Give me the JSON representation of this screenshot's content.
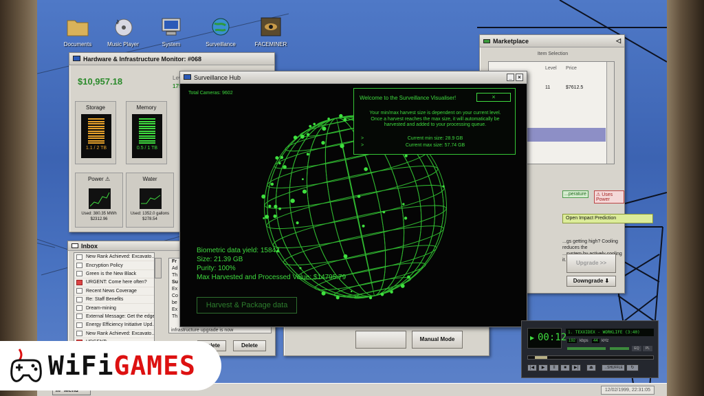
{
  "desktop": {
    "icons": [
      {
        "label": "Documents",
        "icon": "folder-icon"
      },
      {
        "label": "Music Player",
        "icon": "cd-icon"
      },
      {
        "label": "System",
        "icon": "computer-icon"
      },
      {
        "label": "Surveillance",
        "icon": "globe-icon"
      },
      {
        "label": "FACEMINER",
        "icon": "faceminer-icon"
      }
    ]
  },
  "hw_monitor": {
    "title": "Hardware & Infrastructure Monitor: #068",
    "money": "$10,957.18",
    "level_label": "Lev",
    "level_value": "175",
    "storage": {
      "label": "Storage",
      "value": "1.1 / 2 TB"
    },
    "memory": {
      "label": "Memory",
      "value": "0.5 / 1 TB"
    },
    "power": {
      "label": "Power ⚠",
      "used": "Used: 380.35 MWh",
      "cost": "$2312.96"
    },
    "water": {
      "label": "Water",
      "used": "Used: 1352.0 gallons",
      "cost": "$278.54"
    }
  },
  "marketplace": {
    "title": "Marketplace",
    "section": "Item Selection",
    "col_level": "Level",
    "col_price": "Price",
    "row_level": "11",
    "row_price": "$7612.5",
    "status_temp": "...perature",
    "status_power": "⚠ Uses Power",
    "impact_btn": "Open Impact Prediction",
    "desc_1": "...gs getting high? Cooling reduces the",
    "desc_2": "...system by actively cooling it.",
    "upgrade_btn": "Upgrade >>",
    "downgrade_btn": "Downgrade ⬇"
  },
  "hub": {
    "title": "Surveillance Hub",
    "total_cameras": "Total Cameras: 9602",
    "welcome_title": "Welcome to the Surveillance Visualiser!",
    "welcome_close": "×",
    "welcome_line1": "Your min/max harvest size is dependent on your current level.",
    "welcome_line2": "Once a harvest reaches the max size, it will automatically be",
    "welcome_line3": "harvested and added to your processing queue.",
    "min_size": "Current min size: 28.9 GB",
    "max_size": "Current max size: 57.74 GB",
    "bullet": ">",
    "biometric": "Biometric data yield: 15843",
    "size": "Size: 21.39 GB",
    "purity": "Purity: 100%",
    "max_value": "Max Harvested and Processed Value: $14795.79",
    "harvest_btn": "Harvest & Package data"
  },
  "inbox": {
    "title": "Inbox",
    "messages": [
      {
        "subject": "New Rank Achieved: Excavato...",
        "urgent": false
      },
      {
        "subject": "Encryption Policy",
        "urgent": false
      },
      {
        "subject": "Green is the New Black",
        "urgent": false
      },
      {
        "subject": "URGENT: Come here often?",
        "urgent": true
      },
      {
        "subject": "Recent News Coverage",
        "urgent": false
      },
      {
        "subject": "Re: Staff Benefits",
        "urgent": false
      },
      {
        "subject": "Dream-mining",
        "urgent": false
      },
      {
        "subject": "External Message: Get the edge...",
        "urgent": false
      },
      {
        "subject": "Energy Efficiency Initiative Upd...",
        "urgent": false
      },
      {
        "subject": "New Rank Achieved: Excavato...",
        "urgent": false
      },
      {
        "subject": "URGENT: ...",
        "urgent": true
      }
    ],
    "preview_lines": [
      "Fr",
      "Ad",
      "Th",
      "Su",
      "Ex",
      "Co",
      "be",
      "Ex",
      "Th"
    ],
    "preview_tail": "infrastructure upgrade is now",
    "delete_btn_a": "Delete",
    "delete_btn_b": "Delete"
  },
  "panel": {
    "manual_btn": "Manual Mode",
    "auto_btn": ""
  },
  "player": {
    "time": "00:12",
    "track": "1. TEXXIDEX - WORKLIFE (3:40)",
    "kbps": "192",
    "kbps_label": "kbps",
    "khz": "44",
    "khz_label": "kHz",
    "shuffle": "→SHUFFLE",
    "eq": "EQ",
    "pl": "PL"
  },
  "taskbar": {
    "menu": "Menu",
    "clock": "12/02/1999, 22:31:05"
  },
  "logo": {
    "text": "WiFiGAMES",
    "part_a": "WiFi",
    "part_b": "GAMES"
  }
}
